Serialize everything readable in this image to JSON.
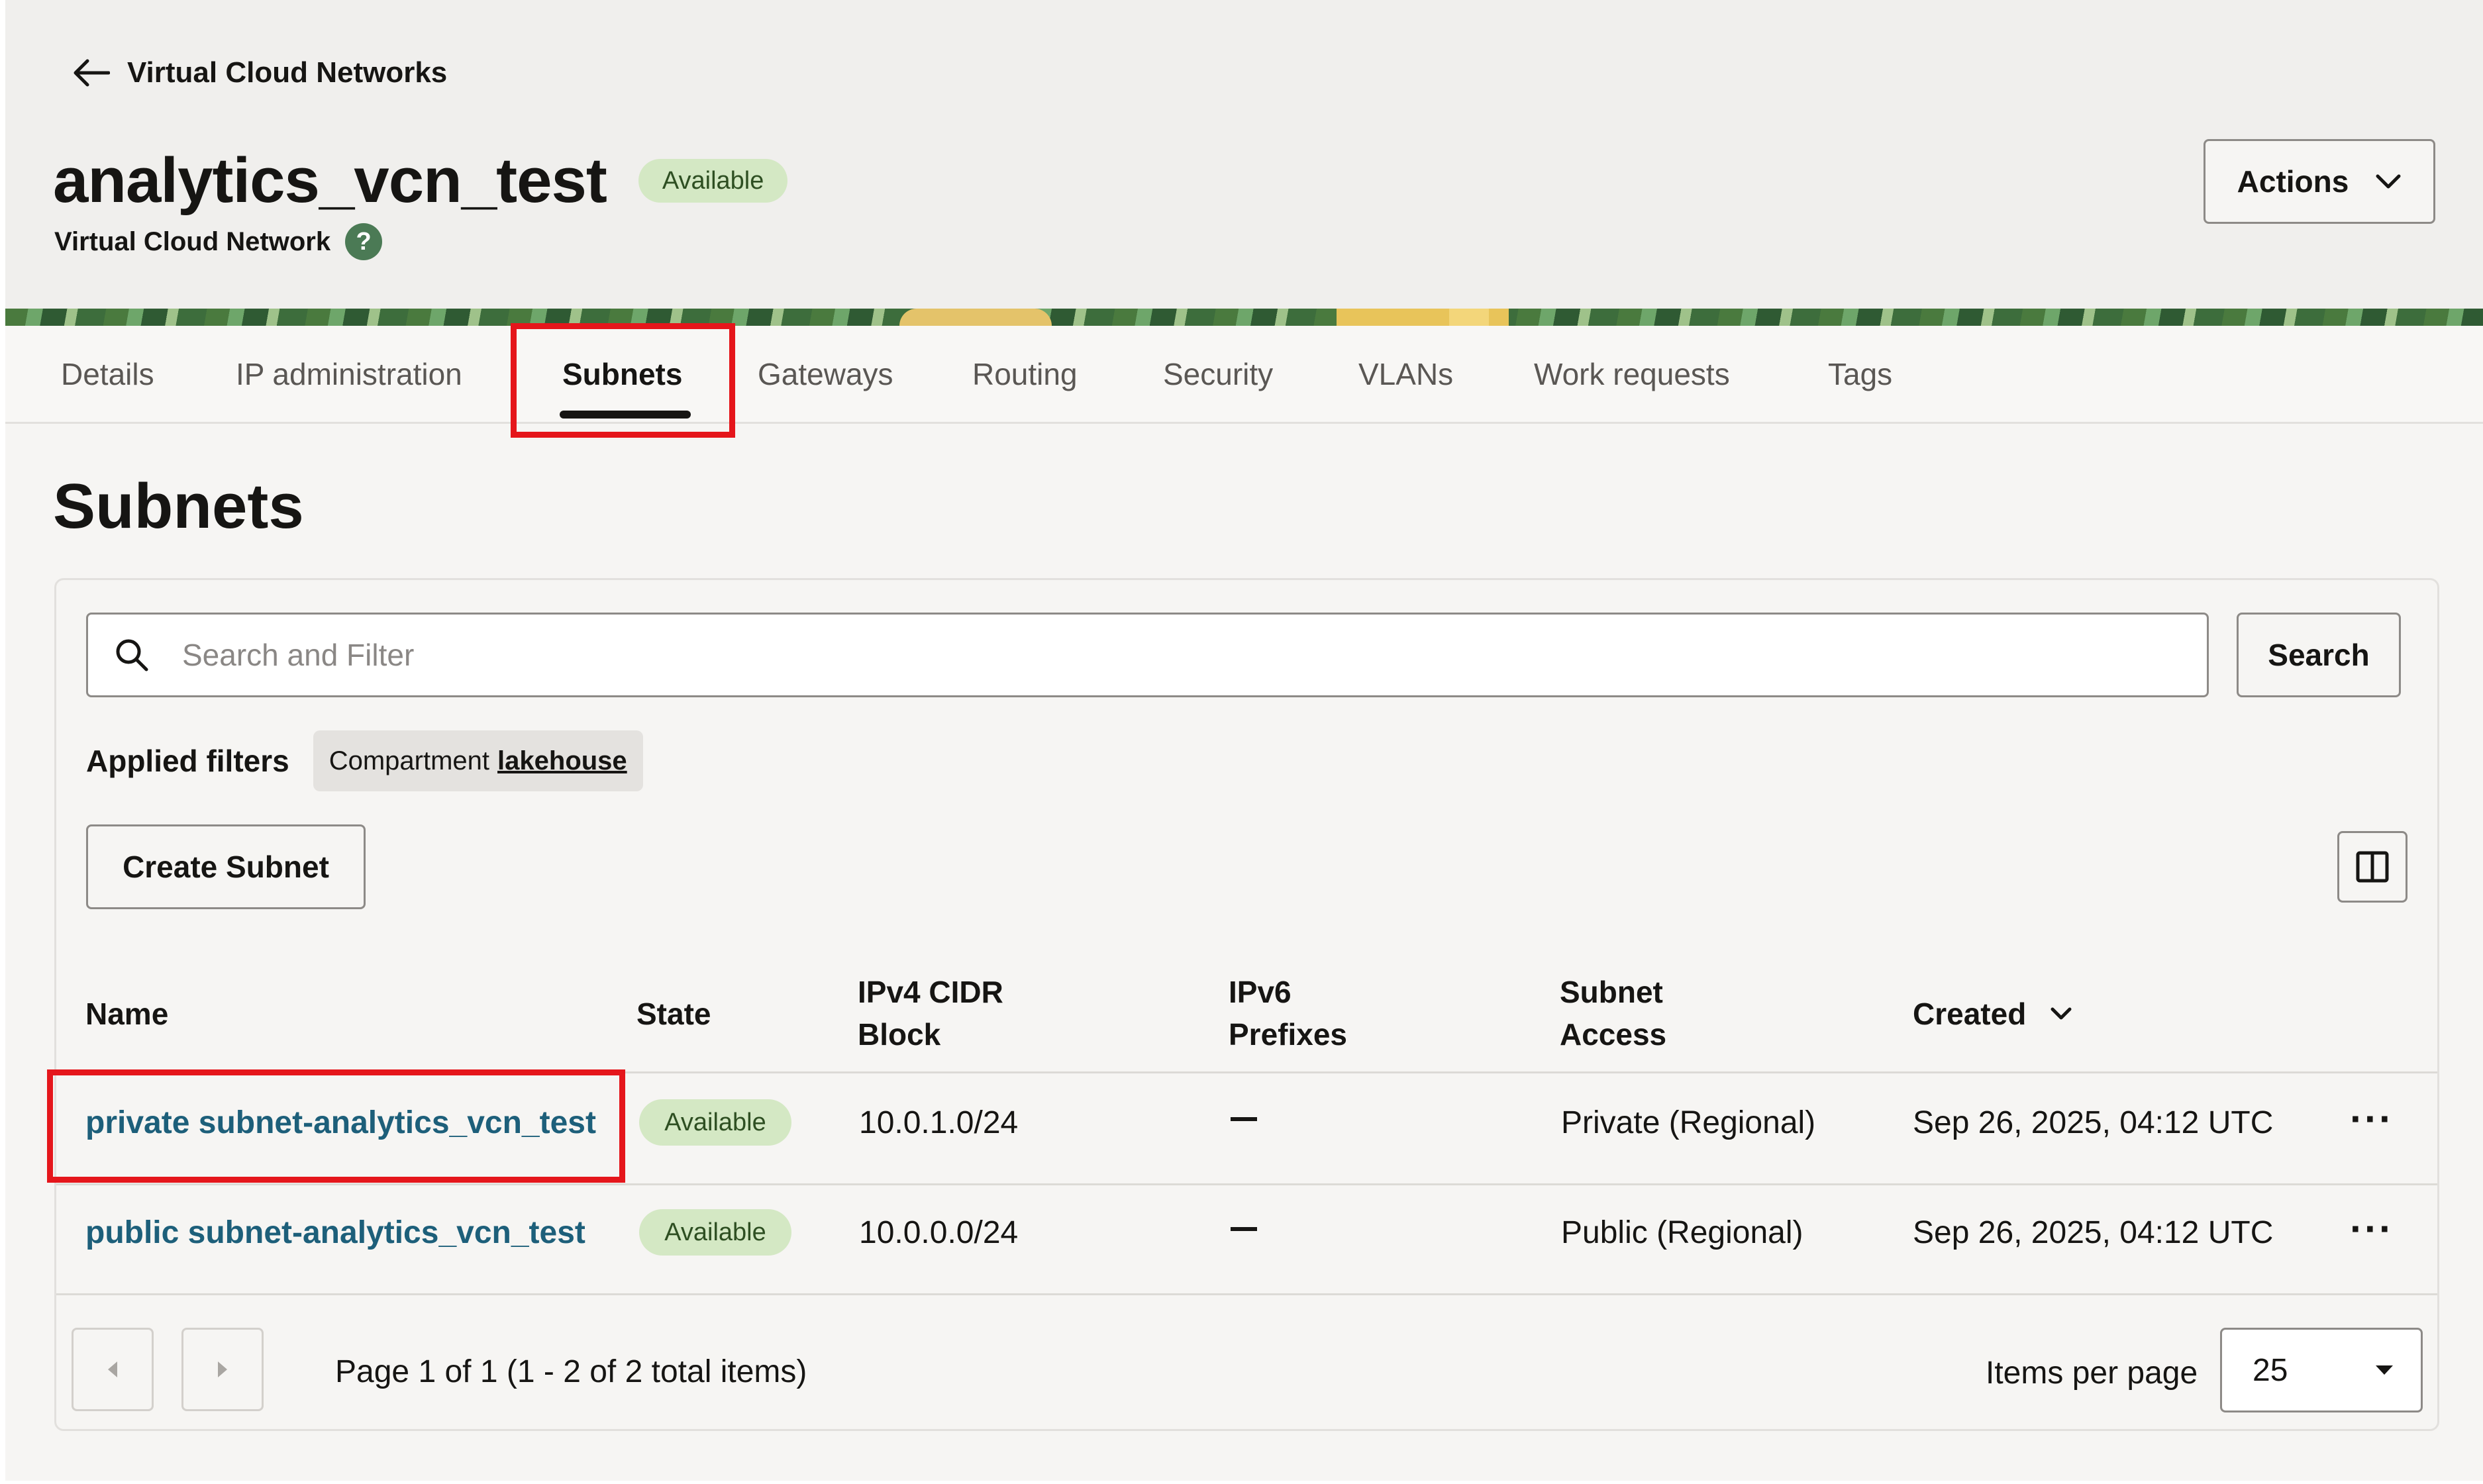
{
  "header": {
    "back_label": "Virtual Cloud Networks",
    "title": "analytics_vcn_test",
    "status": "Available",
    "resource_type": "Virtual Cloud Network",
    "help": "?",
    "actions_label": "Actions"
  },
  "tabs": [
    {
      "label": "Details"
    },
    {
      "label": "IP administration"
    },
    {
      "label": "Subnets",
      "active": true
    },
    {
      "label": "Gateways"
    },
    {
      "label": "Routing"
    },
    {
      "label": "Security"
    },
    {
      "label": "VLANs"
    },
    {
      "label": "Work requests"
    },
    {
      "label": "Tags"
    }
  ],
  "section": {
    "title": "Subnets",
    "search_placeholder": "Search and Filter",
    "search_button": "Search",
    "applied_filters_label": "Applied filters",
    "filter_chip": {
      "key": "Compartment",
      "value": "lakehouse"
    },
    "create_button": "Create Subnet"
  },
  "table": {
    "columns": [
      {
        "line1": "Name",
        "line2": ""
      },
      {
        "line1": "State",
        "line2": ""
      },
      {
        "line1": "IPv4 CIDR",
        "line2": "Block"
      },
      {
        "line1": "IPv6",
        "line2": "Prefixes"
      },
      {
        "line1": "Subnet",
        "line2": "Access"
      },
      {
        "line1": "Created",
        "line2": ""
      }
    ],
    "rows": [
      {
        "name": "private subnet-analytics_vcn_test",
        "state": "Available",
        "ipv4": "10.0.1.0/24",
        "ipv6": "—",
        "access": "Private (Regional)",
        "created": "Sep 26, 2025, 04:12 UTC",
        "more": "···"
      },
      {
        "name": "public subnet-analytics_vcn_test",
        "state": "Available",
        "ipv4": "10.0.0.0/24",
        "ipv6": "—",
        "access": "Public (Regional)",
        "created": "Sep 26, 2025, 04:12 UTC",
        "more": "···"
      }
    ]
  },
  "pagination": {
    "text": "Page 1 of 1 (1 - 2 of 2 total items)",
    "items_per_page_label": "Items per page",
    "items_per_page": "25"
  },
  "colors": {
    "accent_link": "#1d5f7a",
    "badge_bg": "#d4e8c4",
    "highlight": "#e5161b"
  }
}
